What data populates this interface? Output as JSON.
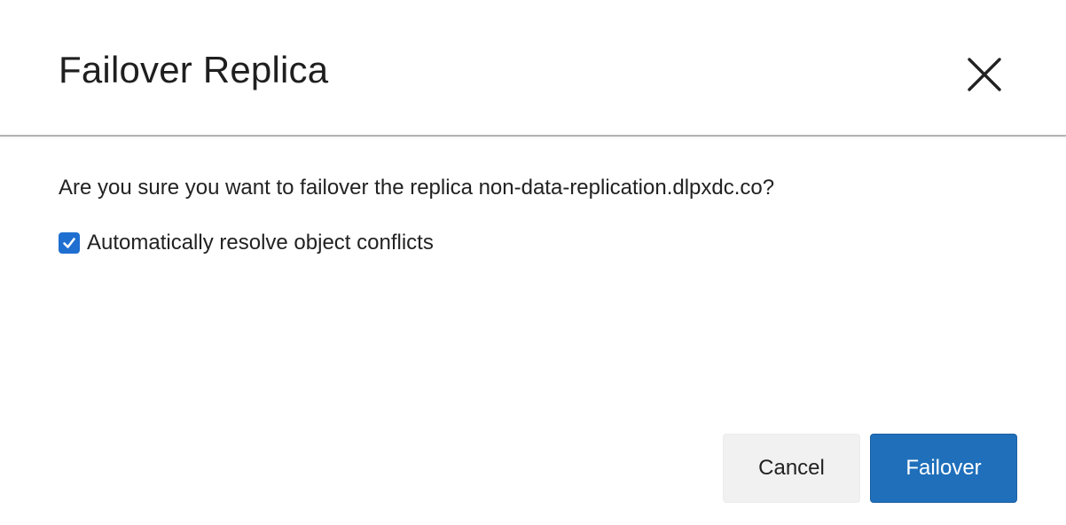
{
  "dialog": {
    "title": "Failover Replica",
    "close_icon": "close-icon",
    "message": "Are you sure you want to failover the replica non-data-replication.dlpxdc.co?",
    "option": {
      "label": "Automatically resolve object conflicts",
      "checked": true,
      "icon": "checkmark-icon"
    },
    "buttons": {
      "cancel_label": "Cancel",
      "confirm_label": "Failover"
    }
  },
  "colors": {
    "primary_button": "#1f6fbb",
    "checkbox_accent": "#1f6fd1",
    "secondary_button": "#f1f1f1",
    "divider": "#b3b3b3"
  }
}
